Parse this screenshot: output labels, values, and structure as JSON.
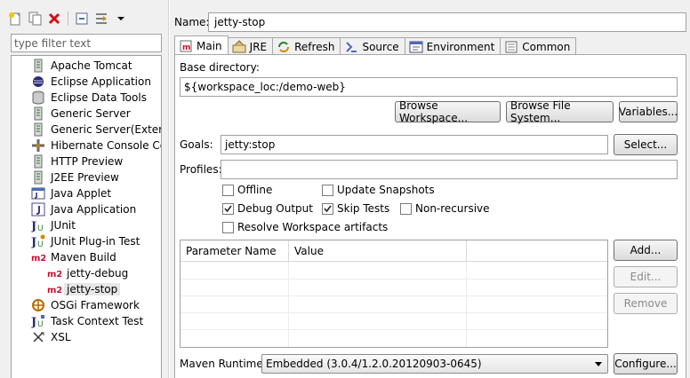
{
  "left": {
    "filter_placeholder": "type filter text",
    "items": [
      {
        "label": "Apache Tomcat",
        "icon": "server-icon"
      },
      {
        "label": "Eclipse Application",
        "icon": "eclipse-app-icon"
      },
      {
        "label": "Eclipse Data Tools",
        "icon": "database-icon"
      },
      {
        "label": "Generic Server",
        "icon": "server-icon"
      },
      {
        "label": "Generic Server(External L",
        "icon": "server-icon"
      },
      {
        "label": "Hibernate Console Conf",
        "icon": "hibernate-icon"
      },
      {
        "label": "HTTP Preview",
        "icon": "server-icon"
      },
      {
        "label": "J2EE Preview",
        "icon": "server-icon"
      },
      {
        "label": "Java Applet",
        "icon": "java-applet-icon"
      },
      {
        "label": "Java Application",
        "icon": "java-app-icon"
      },
      {
        "label": "JUnit",
        "icon": "junit-icon"
      },
      {
        "label": "JUnit Plug-in Test",
        "icon": "junit-plugin-icon"
      },
      {
        "label": "Maven Build",
        "icon": "maven-icon"
      },
      {
        "label": "jetty-debug",
        "icon": "maven-icon"
      },
      {
        "label": "jetty-stop",
        "icon": "maven-icon"
      },
      {
        "label": "OSGi Framework",
        "icon": "osgi-icon"
      },
      {
        "label": "Task Context Test",
        "icon": "task-test-icon"
      },
      {
        "label": "XSL",
        "icon": "xsl-icon"
      }
    ]
  },
  "name": {
    "label": "Name:",
    "value": "jetty-stop"
  },
  "tabs": [
    {
      "label": "Main",
      "icon": "main-tab-icon"
    },
    {
      "label": "JRE",
      "icon": "jre-icon"
    },
    {
      "label": "Refresh",
      "icon": "refresh-icon"
    },
    {
      "label": "Source",
      "icon": "source-icon"
    },
    {
      "label": "Environment",
      "icon": "environment-icon"
    },
    {
      "label": "Common",
      "icon": "common-icon"
    }
  ],
  "main": {
    "base_dir_label": "Base directory:",
    "base_dir_value": "${workspace_loc:/demo-web}",
    "browse_workspace": "Browse Workspace...",
    "browse_fs": "Browse File System...",
    "variables": "Variables...",
    "goals_label": "Goals:",
    "goals_value": "jetty:stop",
    "select": "Select...",
    "profiles_label": "Profiles:",
    "profiles_value": "",
    "checks": {
      "offline": {
        "label": "Offline",
        "checked": false
      },
      "update_snapshots": {
        "label": "Update Snapshots",
        "checked": false
      },
      "debug_output": {
        "label": "Debug Output",
        "checked": true
      },
      "skip_tests": {
        "label": "Skip Tests",
        "checked": true
      },
      "non_recursive": {
        "label": "Non-recursive",
        "checked": false
      },
      "resolve_ws": {
        "label": "Resolve Workspace artifacts",
        "checked": false
      }
    },
    "table": {
      "col1": "Parameter Name",
      "col2": "Value"
    },
    "add": "Add...",
    "edit": "Edit...",
    "remove": "Remove",
    "runtime_label": "Maven Runtime:",
    "runtime_value": "Embedded (3.0.4/1.2.0.20120903-0645)",
    "configure": "Configure..."
  }
}
